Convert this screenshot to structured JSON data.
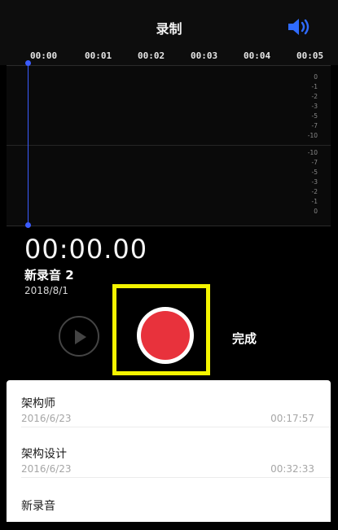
{
  "header": {
    "title": "录制"
  },
  "timeline": {
    "ticks": [
      "00:00",
      "00:01",
      "00:02",
      "00:03",
      "00:04",
      "00:05"
    ]
  },
  "waveform": {
    "scale_top": [
      "0",
      "-1",
      "-2",
      "-3",
      "-5",
      "-7",
      "-10"
    ],
    "scale_bottom": [
      "-10",
      "-7",
      "-5",
      "-3",
      "-2",
      "-1",
      "0"
    ]
  },
  "recording": {
    "time": "00:00.00",
    "name": "新录音 2",
    "date": "2018/8/1"
  },
  "controls": {
    "done_label": "完成"
  },
  "list": {
    "items": [
      {
        "title": "架构师",
        "date": "2016/6/23",
        "duration": "00:17:57"
      },
      {
        "title": "架构设计",
        "date": "2016/6/23",
        "duration": "00:32:33"
      },
      {
        "title": "新录音",
        "date": "",
        "duration": ""
      }
    ]
  },
  "colors": {
    "accent_blue": "#3b5cff",
    "record_red": "#e8323c",
    "highlight_yellow": "#f4f400"
  },
  "icons": {
    "speaker": "speaker-icon",
    "play": "play-icon",
    "record": "record-icon"
  }
}
